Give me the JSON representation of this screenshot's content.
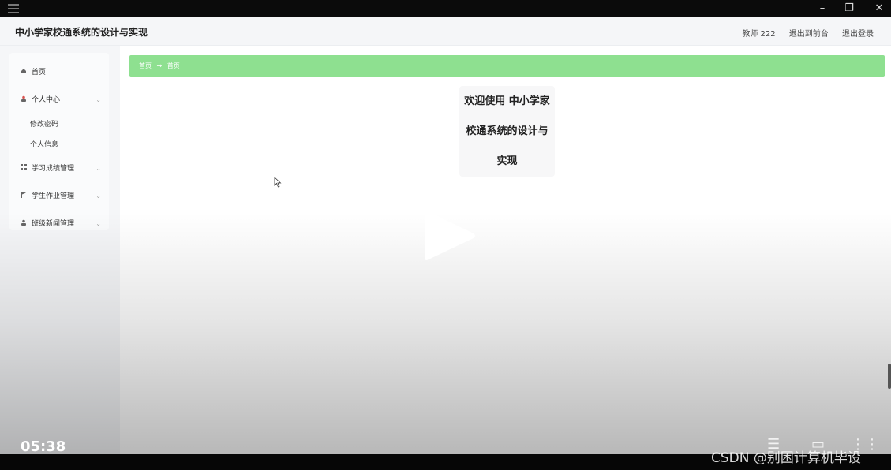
{
  "window": {
    "minimize_glyph": "–",
    "restore_glyph": "❐",
    "close_glyph": "✕"
  },
  "header": {
    "title": "中小学家校通系统的设计与实现",
    "user": "教师 222",
    "exit_front": "退出到前台",
    "logout": "退出登录"
  },
  "sidebar": {
    "items": [
      {
        "icon": "home-icon",
        "label": "首页"
      },
      {
        "icon": "user-icon",
        "label": "个人中心",
        "children": [
          "修改密码",
          "个人信息"
        ]
      },
      {
        "icon": "grid-icon",
        "label": "学习成绩管理"
      },
      {
        "icon": "flag-icon",
        "label": "学生作业管理"
      },
      {
        "icon": "person-icon",
        "label": "班级新闻管理"
      }
    ]
  },
  "breadcrumb": {
    "home": "首页",
    "arrow": "→",
    "current": "首页"
  },
  "welcome": {
    "line1": "欢迎使用 中小学家",
    "line2": "校通系统的设计与",
    "line3": "实现"
  },
  "video": {
    "time": "05:38",
    "watermark": "CSDN @别困计算机毕设"
  },
  "colors": {
    "breadcrumb_bg": "#8ee090",
    "sidebar_bg": "#f5f6f8"
  }
}
